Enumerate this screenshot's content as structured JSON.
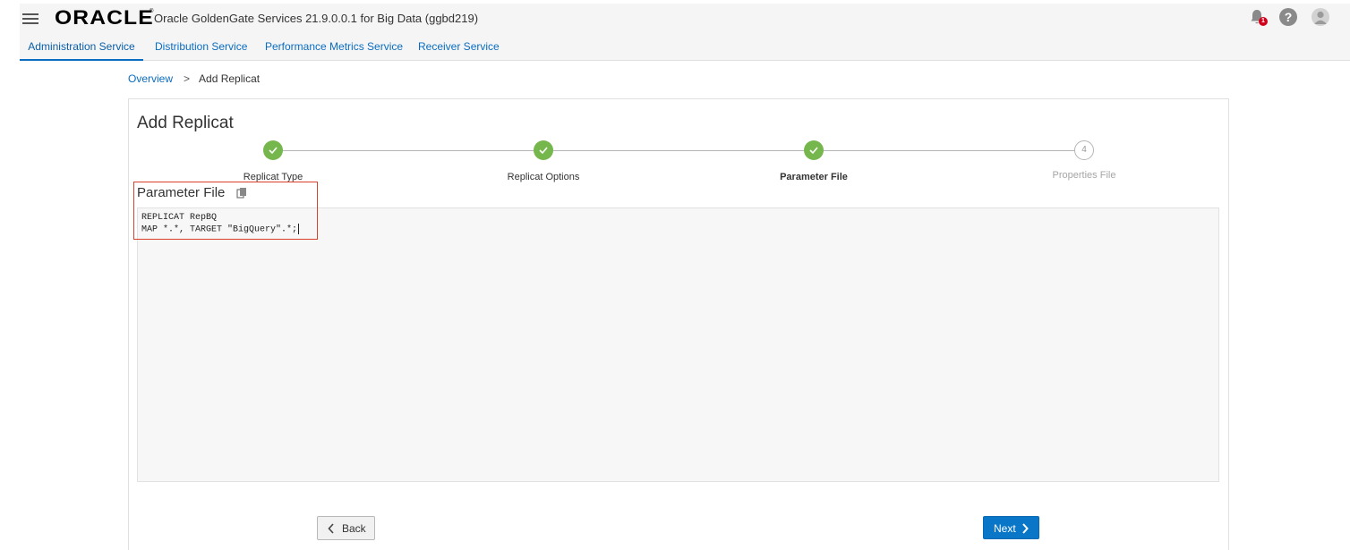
{
  "header": {
    "menu_icon": "hamburger-menu-icon",
    "logo_text": "ORACLE",
    "logo_mark": "®",
    "app_title": "Oracle GoldenGate Services 21.9.0.0.1 for Big Data (ggbd219)",
    "notifications_icon": "bell-icon",
    "notifications_count": "1",
    "help_icon": "help-icon",
    "help_glyph": "?",
    "user_icon": "user-avatar-icon"
  },
  "nav": {
    "tabs": [
      {
        "label": "Administration Service",
        "active": true
      },
      {
        "label": "Distribution Service",
        "active": false
      },
      {
        "label": "Performance Metrics Service",
        "active": false
      },
      {
        "label": "Receiver Service",
        "active": false
      }
    ]
  },
  "breadcrumb": {
    "root": "Overview",
    "separator": ">",
    "current": "Add Replicat"
  },
  "page": {
    "title": "Add Replicat"
  },
  "wizard": {
    "steps": [
      {
        "label": "Replicat Type",
        "status": "complete"
      },
      {
        "label": "Replicat Options",
        "status": "complete"
      },
      {
        "label": "Parameter File",
        "status": "current"
      },
      {
        "label": "Properties File",
        "status": "pending",
        "number": "4"
      }
    ],
    "complete_color": "#75b74d"
  },
  "parameter_file": {
    "heading": "Parameter File",
    "copy_icon": "copy-icon",
    "lines": [
      "REPLICAT RepBQ",
      "MAP *.*, TARGET \"BigQuery\".*;"
    ]
  },
  "buttons": {
    "back_label": "Back",
    "next_label": "Next",
    "next_color": "#0a76c8"
  }
}
